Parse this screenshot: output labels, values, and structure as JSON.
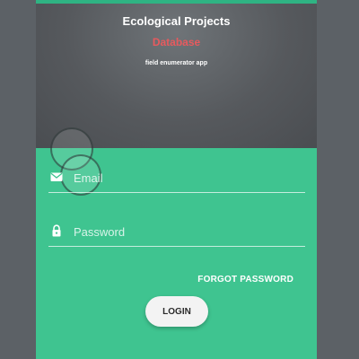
{
  "header": {
    "title": "Ecological Projects",
    "subtitle": "Database",
    "tagline": "field enumerator app"
  },
  "form": {
    "email": {
      "placeholder": "Email",
      "value": "",
      "icon": "envelope-icon"
    },
    "password": {
      "placeholder": "Password",
      "value": "",
      "icon": "lock-icon"
    },
    "forgot_label": "FORGOT PASSWORD",
    "login_label": "LOGIN"
  },
  "colors": {
    "accent_green": "#3fc490",
    "header_gray": "#56595d",
    "subtitle_red": "#e75a5e",
    "button_bg": "#f3f3f3"
  }
}
